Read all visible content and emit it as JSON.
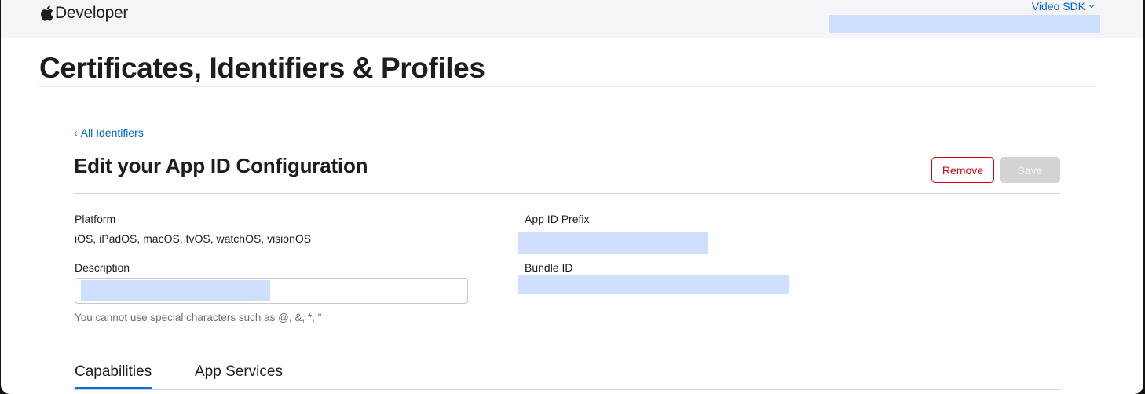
{
  "header": {
    "brand_text": "Developer",
    "brand_icon": "apple-logo-icon",
    "team_name": "Video SDK"
  },
  "page": {
    "title": "Certificates, Identifiers & Profiles"
  },
  "breadcrumb": {
    "back_label": "All Identifiers"
  },
  "section": {
    "title": "Edit your App ID Configuration",
    "remove_label": "Remove",
    "save_label": "Save"
  },
  "fields": {
    "platform_label": "Platform",
    "platform_value": "iOS, iPadOS, macOS, tvOS, watchOS, visionOS",
    "description_label": "Description",
    "description_value": "",
    "description_hint": "You cannot use special characters such as @, &, *, \"",
    "prefix_label": "App ID Prefix",
    "bundle_label": "Bundle ID"
  },
  "tabs": [
    {
      "label": "Capabilities",
      "active": true
    },
    {
      "label": "App Services",
      "active": false
    }
  ],
  "colors": {
    "accent": "#0066cc",
    "danger": "#d70015",
    "redaction": "#cfe0ff"
  }
}
